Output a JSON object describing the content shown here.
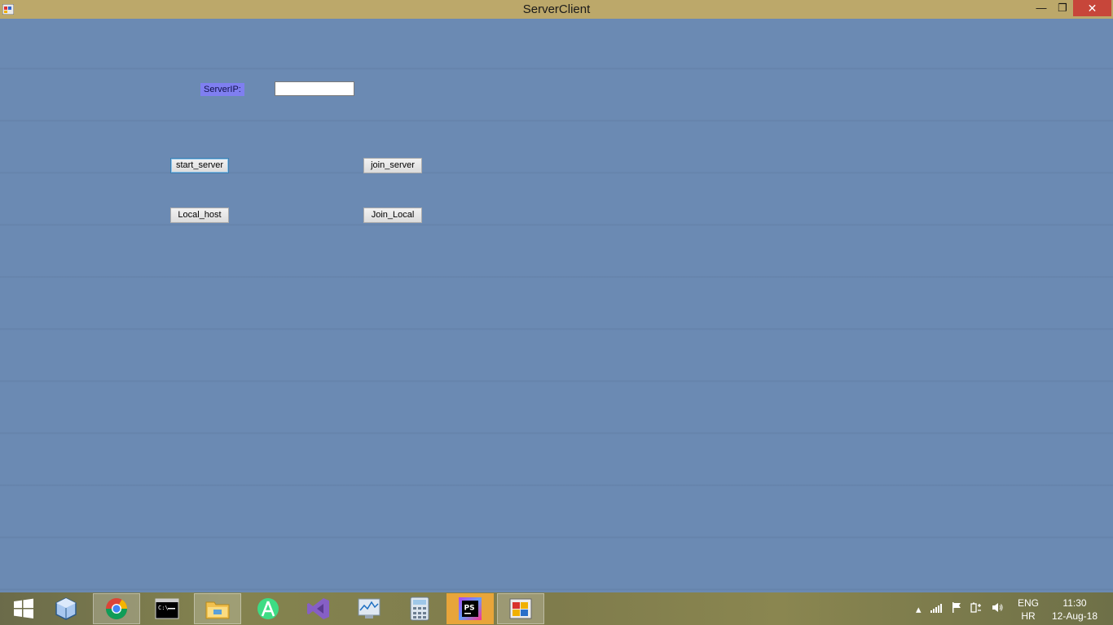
{
  "window": {
    "title": "ServerClient",
    "minimize": "—",
    "restore": "❐",
    "close": "✕"
  },
  "form": {
    "server_ip_label": "ServerIP:",
    "server_ip_value": "",
    "start_server_label": "start_server",
    "join_server_label": "join_server",
    "local_host_label": "Local_host",
    "join_local_label": "Join_Local"
  },
  "taskbar": {
    "items": [
      {
        "icon": "windows-start-icon"
      },
      {
        "icon": "virtualbox-icon"
      },
      {
        "icon": "chrome-icon"
      },
      {
        "icon": "command-prompt-icon"
      },
      {
        "icon": "file-explorer-icon"
      },
      {
        "icon": "android-studio-icon"
      },
      {
        "icon": "visual-studio-icon"
      },
      {
        "icon": "performance-monitor-icon"
      },
      {
        "icon": "calculator-icon"
      },
      {
        "icon": "phpstorm-icon",
        "label": "PS"
      },
      {
        "icon": "winforms-app-icon"
      }
    ],
    "language_top": "ENG",
    "language_bottom": "HR",
    "time": "11:30",
    "date": "12-Aug-18"
  },
  "colors": {
    "titlebar": "#bca86a",
    "client_background": "#6b8ab3",
    "label_background": "#7f7ff0",
    "close_button": "#c7463a"
  }
}
